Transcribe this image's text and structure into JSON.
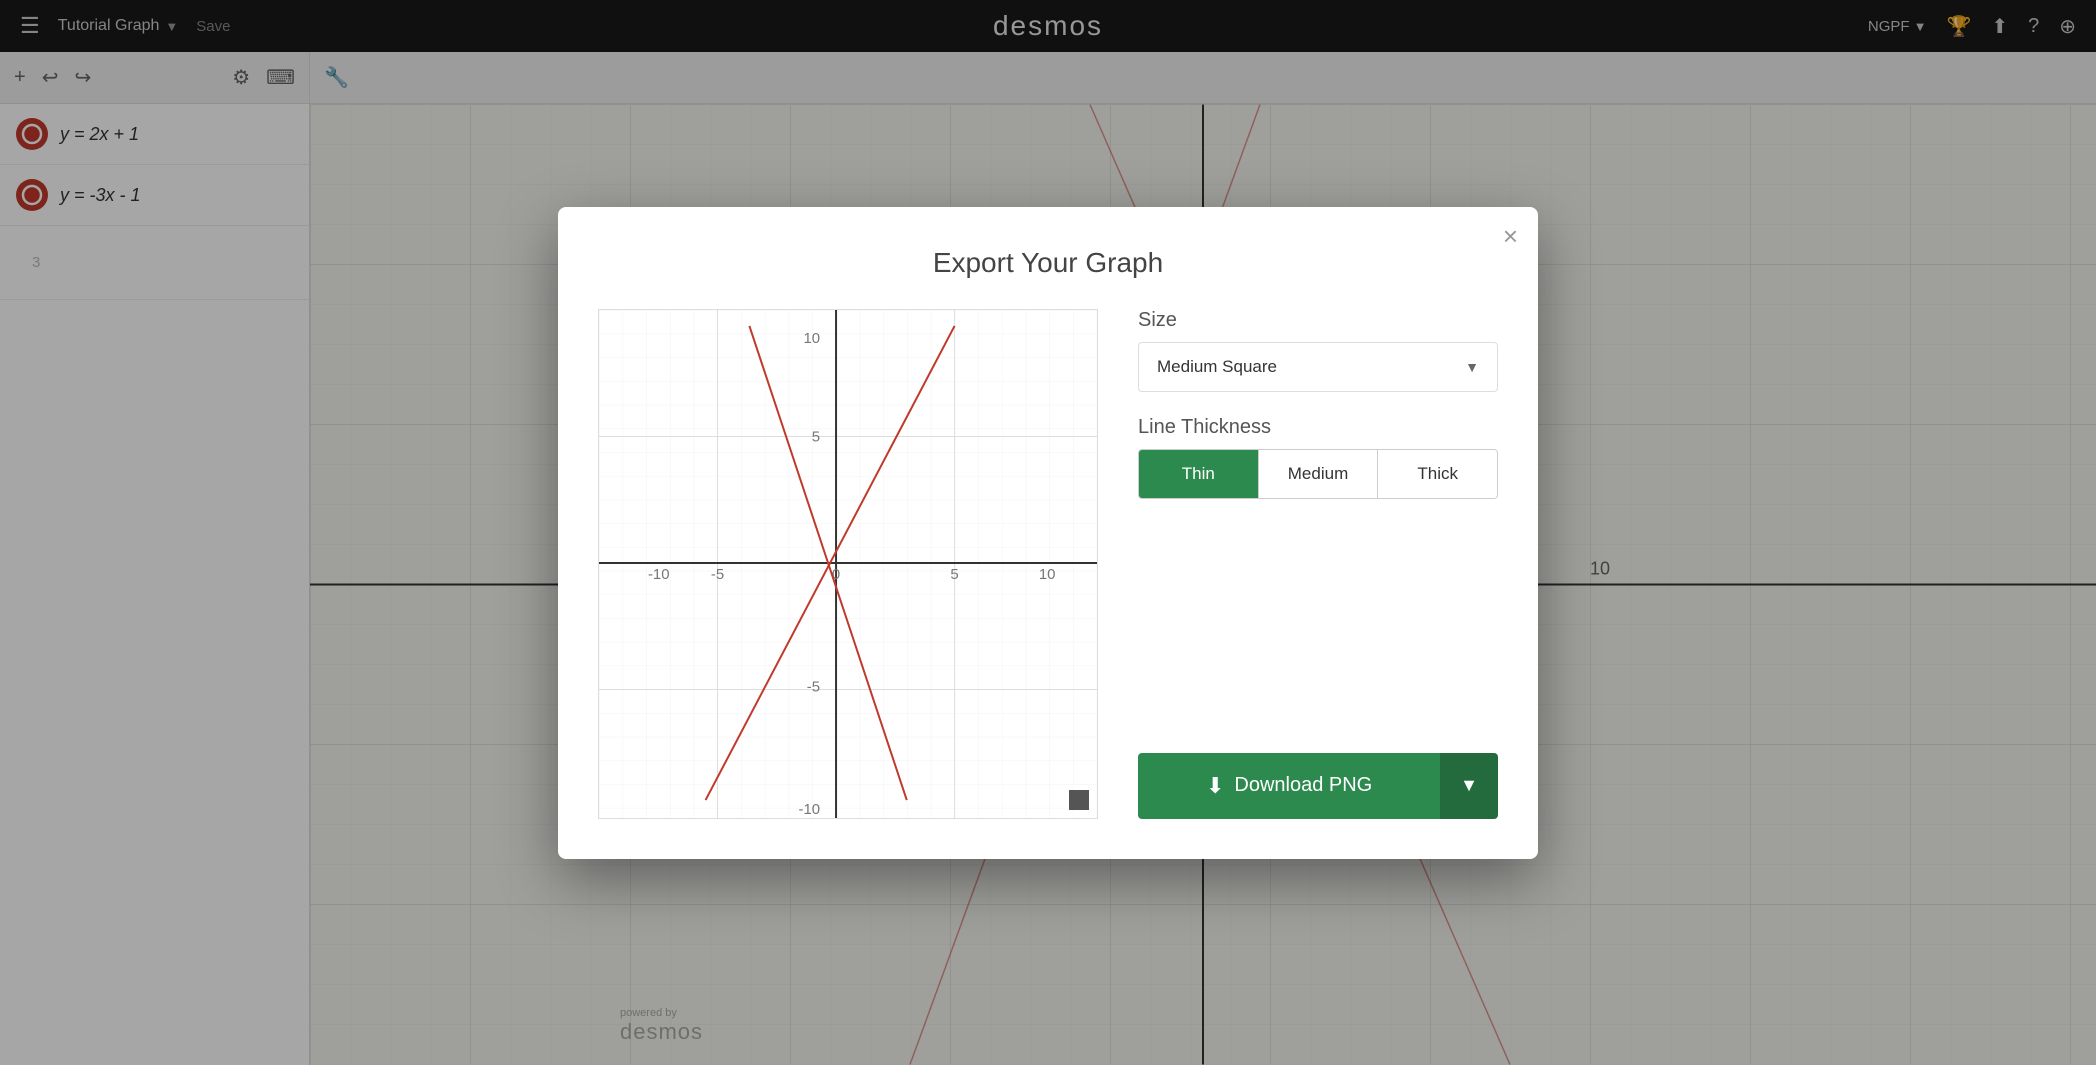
{
  "app": {
    "title": "desmos",
    "nav_title": "Tutorial Graph",
    "save_label": "Save"
  },
  "nav": {
    "ngpf_label": "NGPF",
    "icons": [
      "hamburger",
      "chevron-down",
      "trophy",
      "share",
      "help",
      "globe"
    ]
  },
  "sidebar": {
    "expressions": [
      {
        "id": 1,
        "formula": "y = 2x + 1"
      },
      {
        "id": 2,
        "formula": "y = -3x - 1"
      }
    ],
    "empty_row": "3"
  },
  "modal": {
    "title": "Export Your Graph",
    "close_label": "×",
    "size_section_label": "Size",
    "size_selected": "Medium Square",
    "line_thickness_label": "Line Thickness",
    "thickness_options": [
      "Thin",
      "Medium",
      "Thick"
    ],
    "thickness_active": "Thin",
    "download_label": "Download PNG"
  },
  "graph": {
    "x_min": -10,
    "x_max": 10,
    "y_min": -10,
    "y_max": 10,
    "axis_labels": {
      "x": [
        "-10",
        "-5",
        "0",
        "5",
        "10"
      ],
      "y": [
        "-10",
        "-5",
        "0",
        "5",
        "10"
      ]
    }
  }
}
